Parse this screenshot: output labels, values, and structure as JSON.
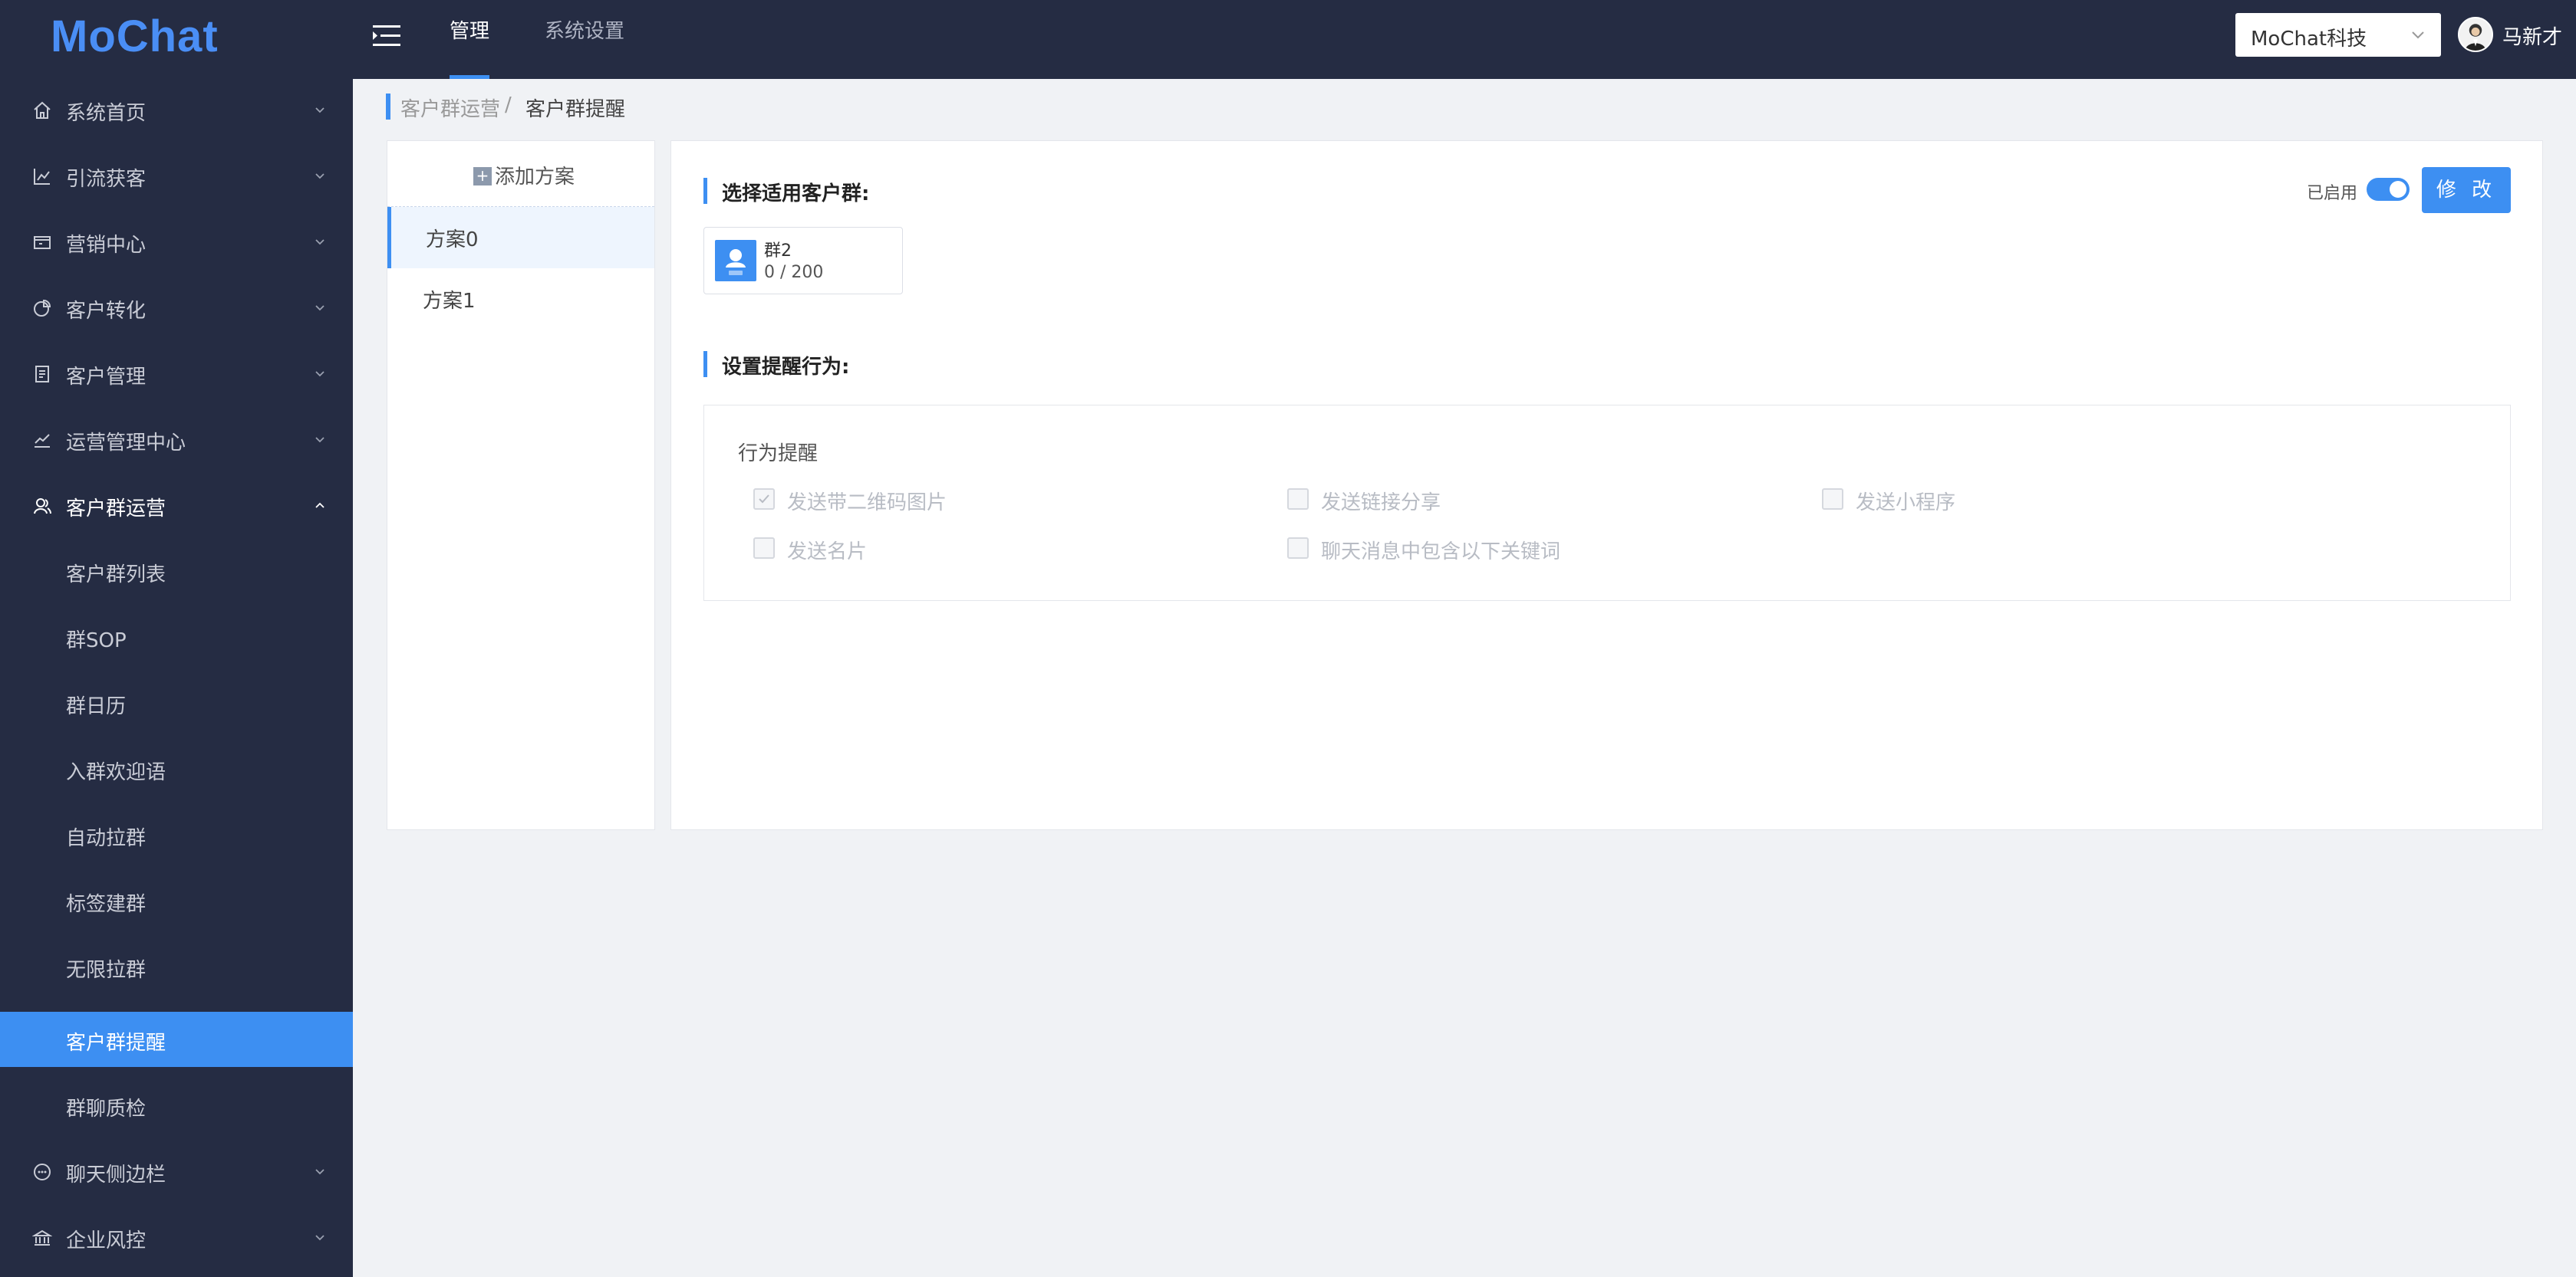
{
  "app": {
    "logo": "MoChat"
  },
  "topnav": {
    "items": [
      {
        "label": "管理"
      },
      {
        "label": "系统设置"
      }
    ],
    "company": "MoChat科技",
    "user": "马新才"
  },
  "sidebar": {
    "items": [
      {
        "label": "系统首页",
        "icon": "home-icon"
      },
      {
        "label": "引流获客",
        "icon": "line-chart-icon"
      },
      {
        "label": "营销中心",
        "icon": "wallet-icon"
      },
      {
        "label": "客户转化",
        "icon": "pie-chart-icon"
      },
      {
        "label": "客户管理",
        "icon": "document-icon"
      },
      {
        "label": "运营管理中心",
        "icon": "trend-icon"
      },
      {
        "label": "客户群运营",
        "icon": "users-icon"
      },
      {
        "label": "聊天侧边栏",
        "icon": "chat-icon"
      },
      {
        "label": "企业风控",
        "icon": "bank-icon"
      }
    ],
    "subitems": [
      {
        "label": "客户群列表"
      },
      {
        "label": "群SOP"
      },
      {
        "label": "群日历"
      },
      {
        "label": "入群欢迎语"
      },
      {
        "label": "自动拉群"
      },
      {
        "label": "标签建群"
      },
      {
        "label": "无限拉群"
      },
      {
        "label": "客户群提醒"
      },
      {
        "label": "群聊质检"
      }
    ]
  },
  "breadcrumb": {
    "parent": "客户群运营",
    "separator": "/",
    "current": "客户群提醒"
  },
  "schemes": {
    "add_label": "添加方案",
    "add_icon": "plus-icon",
    "items": [
      {
        "label": "方案0"
      },
      {
        "label": "方案1"
      }
    ]
  },
  "main": {
    "select_group_title": "选择适用客户群:",
    "enabled_label": "已启用",
    "edit_button": "修 改",
    "group": {
      "name": "群2",
      "count": "0 / 200"
    },
    "behavior_title": "设置提醒行为:",
    "behavior_box_title": "行为提醒",
    "checks": [
      {
        "label": "发送带二维码图片",
        "checked": true
      },
      {
        "label": "发送链接分享",
        "checked": false
      },
      {
        "label": "发送小程序",
        "checked": false
      },
      {
        "label": "发送名片",
        "checked": false
      },
      {
        "label": "聊天消息中包含以下关键词",
        "checked": false
      }
    ]
  },
  "colors": {
    "nav_bg": "#252c43",
    "accent": "#3d8ff2",
    "page_bg": "#f0f2f5"
  }
}
